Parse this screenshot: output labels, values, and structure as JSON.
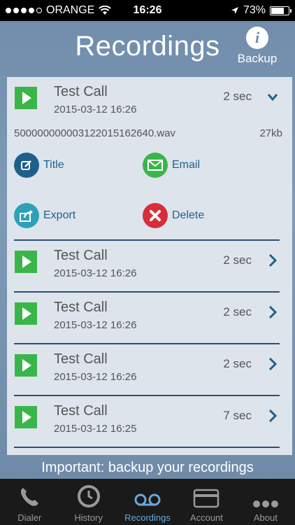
{
  "status_bar": {
    "carrier": "ORANGE",
    "time": "16:26",
    "battery": "73%",
    "battery_level": 0.73,
    "signal_icon": "signal-dots-icon",
    "wifi_icon": "wifi-icon",
    "location_icon": "location-arrow-icon"
  },
  "header": {
    "title": "Recordings",
    "backup_label": "Backup",
    "info_glyph": "i"
  },
  "recordings": [
    {
      "title": "Test Call",
      "date": "2015-03-12 16:26",
      "duration": "2 sec",
      "expanded": true,
      "file_name": "500000000003122015162640.wav",
      "file_size": "27kb",
      "actions": {
        "title_label": "Title",
        "email_label": "Email",
        "export_label": "Export",
        "delete_label": "Delete"
      }
    },
    {
      "title": "Test Call",
      "date": "2015-03-12 16:26",
      "duration": "2 sec"
    },
    {
      "title": "Test Call",
      "date": "2015-03-12 16:26",
      "duration": "2 sec"
    },
    {
      "title": "Test Call",
      "date": "2015-03-12 16:26",
      "duration": "2 sec"
    },
    {
      "title": "Test Call",
      "date": "2015-03-12 16:25",
      "duration": "7 sec"
    }
  ],
  "banner": "Important: backup your recordings",
  "tabs": [
    {
      "label": "Dialer",
      "icon": "phone-icon"
    },
    {
      "label": "History",
      "icon": "clock-icon"
    },
    {
      "label": "Recordings",
      "icon": "voicemail-icon",
      "active": true
    },
    {
      "label": "Account",
      "icon": "credit-card-icon"
    },
    {
      "label": "About",
      "icon": "more-dots-icon"
    }
  ],
  "colors": {
    "accent_blue": "#1f5f8b",
    "play_green": "#3ab54a",
    "email_green": "#3ab54a",
    "delete_red": "#d62e3a",
    "title_icon_blue": "#1f5f8b",
    "export_icon_teal": "#2ea0b8",
    "active_tab": "#6aa8e0"
  }
}
